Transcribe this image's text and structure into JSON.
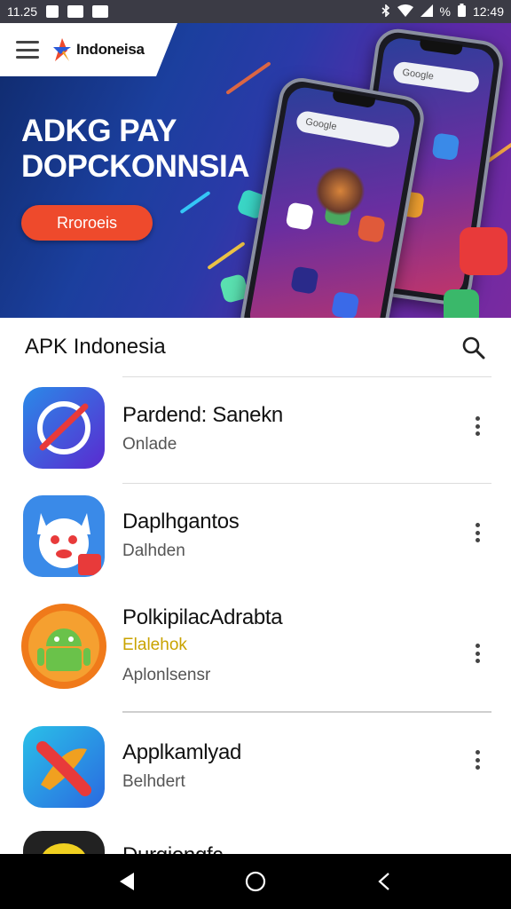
{
  "status_bar": {
    "time_left": "11.25",
    "time_right": "12:49",
    "battery_text": "%"
  },
  "header": {
    "brand_name": "Indoneisa"
  },
  "hero": {
    "title_line1": "ADKG PAY",
    "title_line2": "DOPCKONNSIA",
    "button_label": "Rroroeis",
    "phone_search_text": "Google"
  },
  "list": {
    "title": "APK Indonesia",
    "items": [
      {
        "name": "Pardend: Sanekn",
        "subtitle": "Onlade",
        "icon": "compass-app-icon"
      },
      {
        "name": "Daplhgantos",
        "subtitle": "Dalhden",
        "icon": "cat-mascot-app-icon"
      },
      {
        "name": "PolkipilacAdrabta",
        "subtitle": "Elalehok",
        "subtitle2": "Aplonlsensr",
        "icon": "android-robot-app-icon"
      },
      {
        "name": "Applkamlyad",
        "subtitle": "Belhdert",
        "icon": "play-arrow-app-icon"
      },
      {
        "name": "Durgiengfc",
        "subtitle": "",
        "icon": "yellow-app-icon"
      }
    ]
  },
  "nav": {
    "back": "back-icon",
    "home": "home-icon",
    "recents": "recents-icon"
  },
  "colors": {
    "accent": "#ee4a2c",
    "hero_start": "#0f2a6b",
    "hero_end": "#7a2aa0"
  }
}
